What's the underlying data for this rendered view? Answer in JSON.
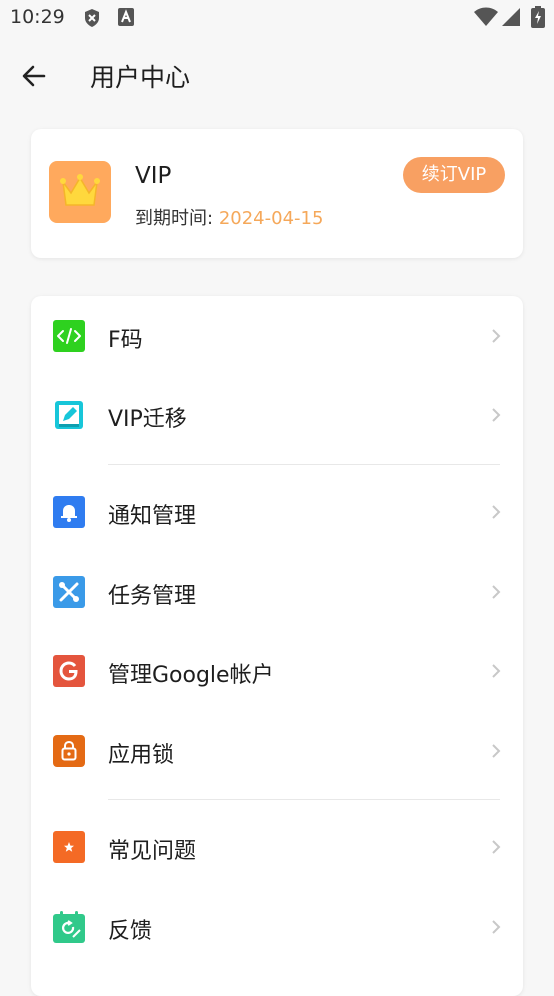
{
  "status_bar": {
    "time": "10:29",
    "icons": [
      "shield-icon",
      "a-icon",
      "wifi-icon",
      "signal-icon",
      "battery-icon"
    ]
  },
  "app_bar": {
    "title": "用户中心",
    "back_icon": "arrow-left-icon"
  },
  "vip": {
    "title": "VIP",
    "expiry_label": "到期时间:",
    "expiry_date": "2024-04-15",
    "renew_label": "续订VIP",
    "badge_icon": "crown-icon",
    "accent": "#f8a062"
  },
  "menu": {
    "items": [
      {
        "label": "F码",
        "icon": "code-icon",
        "color": "#2ed11f"
      },
      {
        "label": "VIP迁移",
        "icon": "edit-icon",
        "color": "#17c6d9"
      },
      {
        "label": "通知管理",
        "icon": "bell-icon",
        "color": "#2f7cf0"
      },
      {
        "label": "任务管理",
        "icon": "tools-icon",
        "color": "#3a9ae8"
      },
      {
        "label": "管理Google帐户",
        "icon": "google-icon",
        "color": "#e4553d"
      },
      {
        "label": "应用锁",
        "icon": "lock-icon",
        "color": "#e46a14"
      },
      {
        "label": "常见问题",
        "icon": "star-icon",
        "color": "#f46a25"
      },
      {
        "label": "反馈",
        "icon": "feedback-icon",
        "color": "#30c98a"
      }
    ]
  }
}
